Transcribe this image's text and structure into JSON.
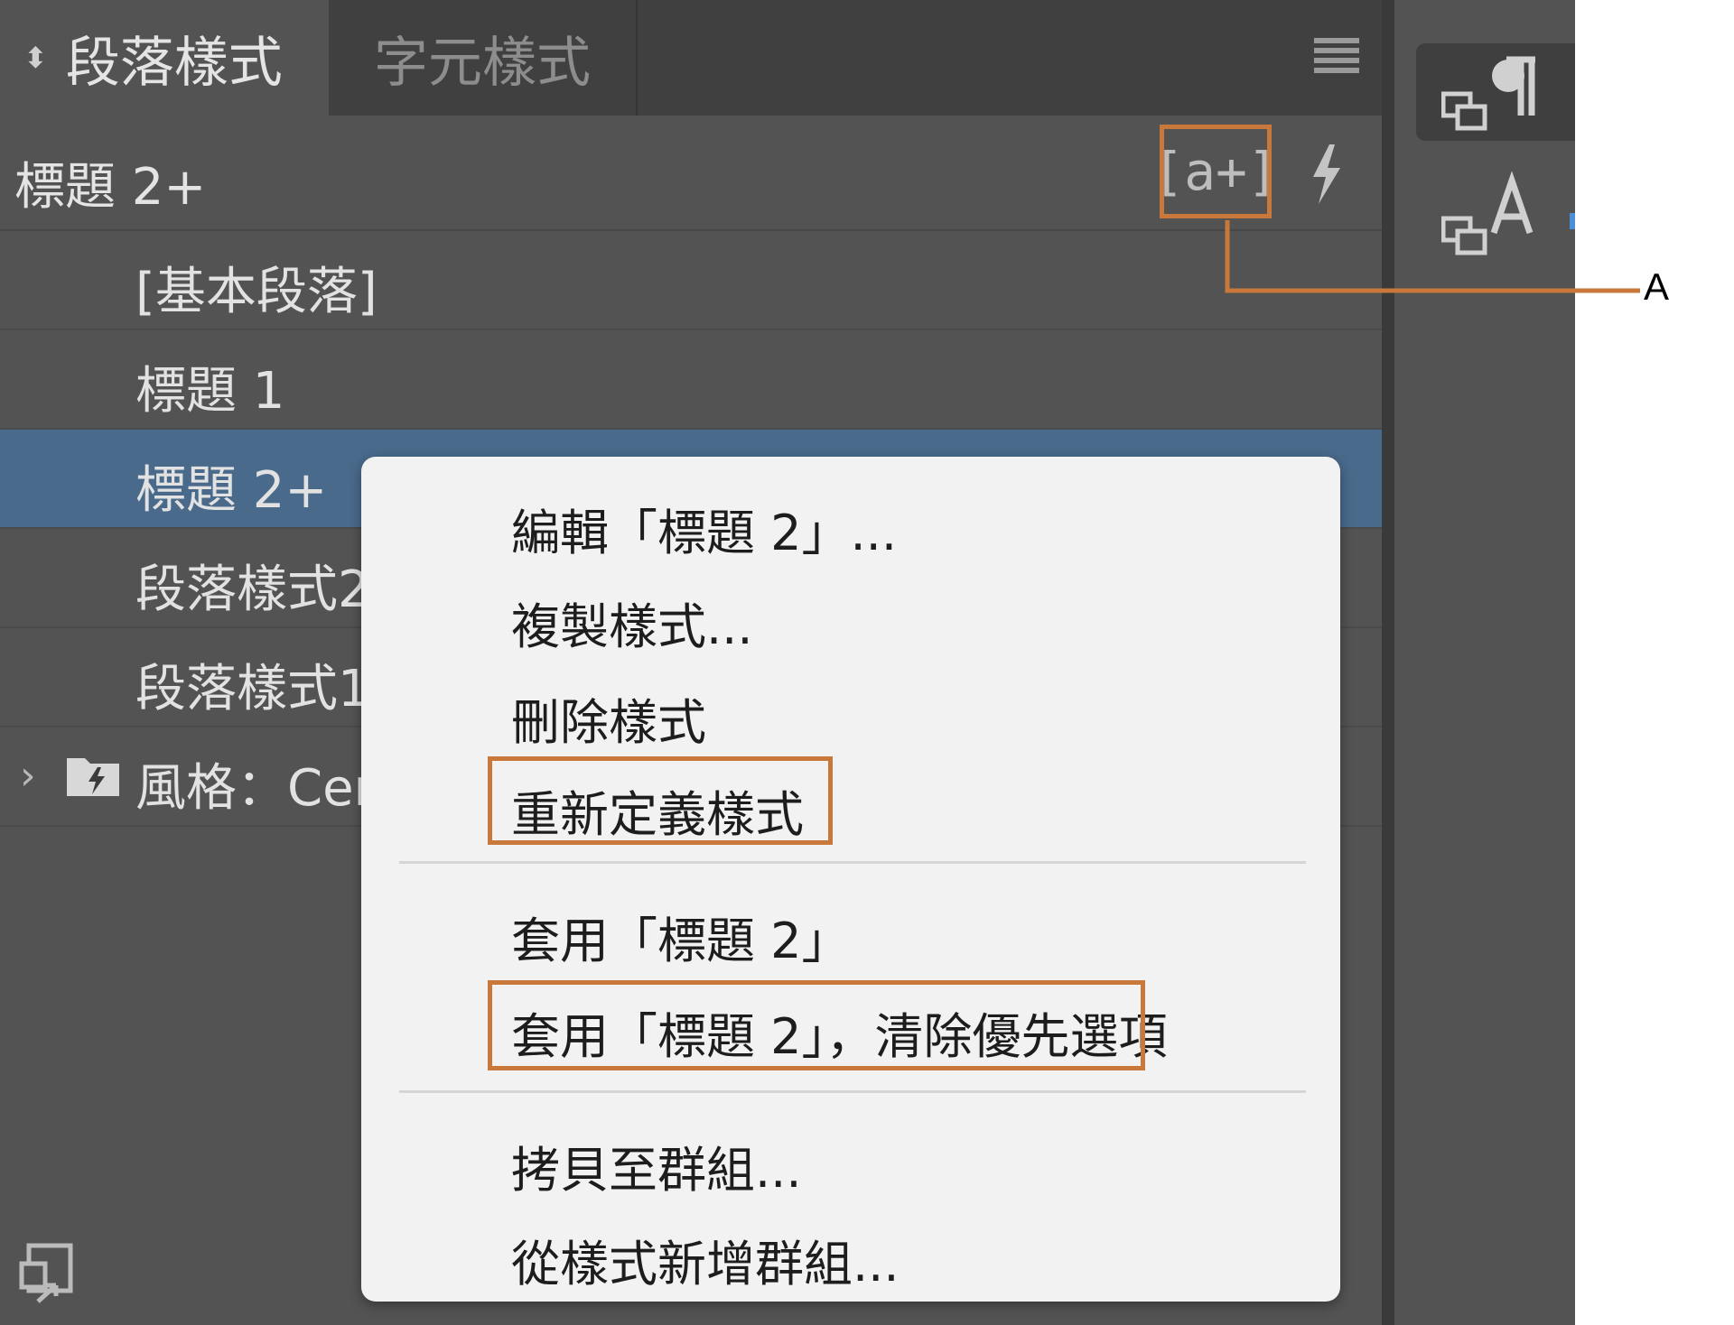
{
  "tabs": {
    "paragraph": "段落樣式",
    "character": "字元樣式"
  },
  "current_style": "標題 2+",
  "toolbar": {
    "new_style_button": "[a+]"
  },
  "styles": [
    {
      "label": "[基本段落]"
    },
    {
      "label": "標題 1"
    },
    {
      "label": "標題 2+"
    },
    {
      "label": "段落樣式2"
    },
    {
      "label": "段落樣式1"
    }
  ],
  "group": {
    "label": "風格：Cere"
  },
  "context_menu": {
    "edit": "編輯「標題 2」...",
    "duplicate": "複製樣式...",
    "delete": "刪除樣式",
    "redefine": "重新定義樣式",
    "apply": "套用「標題 2」",
    "apply_clear": "套用「標題 2」，清除優先選項",
    "copy_to_group": "拷貝至群組...",
    "new_group": "從樣式新增群組..."
  },
  "callout": {
    "label": "A"
  },
  "colors": {
    "highlight": "#c8783a",
    "selected_row": "#4a6a8c",
    "panel": "#535353"
  }
}
